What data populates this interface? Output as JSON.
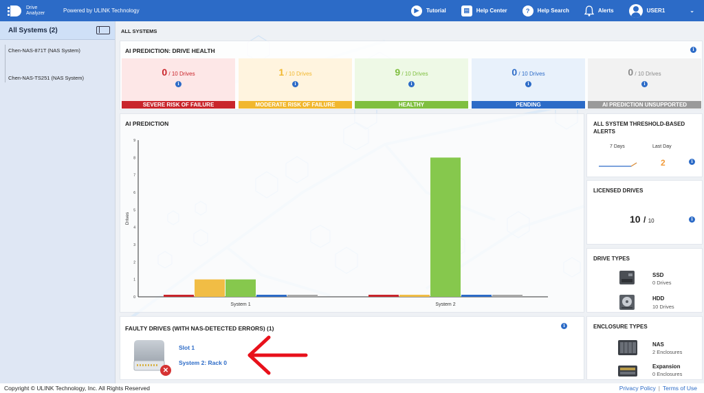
{
  "header": {
    "logo_line1": "Drive",
    "logo_line2": "Analyzer",
    "powered": "Powered by ULINK Technology",
    "tutorial": "Tutorial",
    "help_center": "Help Center",
    "help_search": "Help Search",
    "alerts": "Alerts",
    "user": "USER1"
  },
  "sidebar": {
    "title": "All Systems (2)",
    "items": [
      "Chen-NAS-871T (NAS System)",
      "Chen-NAS-TS251 (NAS System)"
    ]
  },
  "page_title": "ALL SYSTEMS",
  "health": {
    "title": "AI PREDICTION: DRIVE HEALTH",
    "cards": [
      {
        "count": "0",
        "total": " / 10 Drives",
        "label": "SEVERE RISK OF FAILURE",
        "color": "#c9252b",
        "bg": "#fde7e7"
      },
      {
        "count": "1",
        "total": " / 10 Drives",
        "label": "MODERATE RISK OF FAILURE",
        "color": "#f1b72e",
        "bg": "#fff4df"
      },
      {
        "count": "9",
        "total": " / 10 Drives",
        "label": "HEALTHY",
        "color": "#7fbf3f",
        "bg": "#eef9e6"
      },
      {
        "count": "0",
        "total": " / 10 Drives",
        "label": "PENDING",
        "color": "#2c6bc7",
        "bg": "#e8f1fb"
      },
      {
        "count": "0",
        "total": " / 10 Drives",
        "label": "AI PREDICTION UNSUPPORTED",
        "color": "#9a9a9a",
        "bg": "#f2f2f2"
      }
    ]
  },
  "prediction": {
    "title": "AI PREDICTION"
  },
  "chart_data": {
    "type": "bar",
    "categories": [
      "System 1",
      "System 2"
    ],
    "series": [
      {
        "name": "SEVERE RISK OF FAILURE",
        "color": "#c9252b",
        "values": [
          0,
          0
        ]
      },
      {
        "name": "MODERATE RISK OF FAILURE",
        "color": "#f1bd45",
        "values": [
          1,
          0
        ]
      },
      {
        "name": "HEALTHY",
        "color": "#86c84d",
        "values": [
          1,
          8
        ]
      },
      {
        "name": "PENDING",
        "color": "#2c6bc7",
        "values": [
          0,
          0
        ]
      },
      {
        "name": "AI PREDICTION UNSUPPORTED",
        "color": "#a8a8a8",
        "values": [
          0,
          0
        ]
      }
    ],
    "ylabel": "Drives",
    "ylim": [
      0,
      9
    ],
    "yticks": [
      "0",
      "1",
      "2",
      "3",
      "4",
      "5",
      "6",
      "7",
      "8",
      "9"
    ],
    "grid": false
  },
  "faulty": {
    "title": "FAULTY DRIVES (WITH NAS-DETECTED ERRORS) (1)",
    "slot": "Slot 1",
    "location": "System 2: Rack 0"
  },
  "alerts_panel": {
    "title": "ALL SYSTEM THRESHOLD-BASED ALERTS",
    "seven_days": "7 Days",
    "last_day": "Last Day",
    "last_day_value": "2"
  },
  "licensed": {
    "title": "LICENSED DRIVES",
    "used": "10",
    "total": "/ ",
    "max": "10"
  },
  "drive_types": {
    "title": "DRIVE TYPES",
    "items": [
      {
        "name": "SSD",
        "count": "0 Drives"
      },
      {
        "name": "HDD",
        "count": "10 Drives"
      }
    ]
  },
  "enclosure_types": {
    "title": "ENCLOSURE TYPES",
    "items": [
      {
        "name": "NAS",
        "count": "2 Enclosures"
      },
      {
        "name": "Expansion",
        "count": "0 Enclosures"
      }
    ]
  },
  "footer": {
    "copyright": "Copyright © ULINK Technology, Inc. All Rights Reserved",
    "privacy": "Privacy Policy",
    "separator": "|",
    "terms": "Terms of Use"
  },
  "colors": {
    "brand": "#2c6bc7",
    "sidebar_bg": "#dfe7f4",
    "alert_accent": "#f19a38"
  }
}
